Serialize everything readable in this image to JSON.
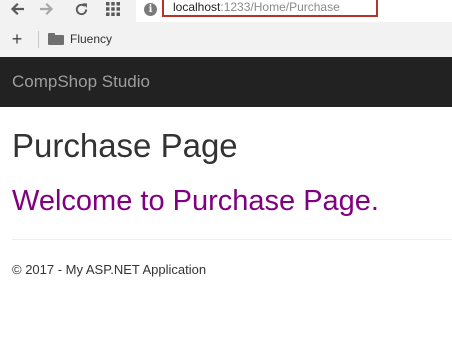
{
  "browser": {
    "url_host": "localhost",
    "url_path": ":1233/Home/Purchase",
    "url_highlight_color": "#b8322a",
    "icons": [
      "back-arrow-icon",
      "forward-arrow-icon",
      "reload-icon",
      "apps-grid-icon",
      "site-info-icon"
    ]
  },
  "bookmarks": {
    "add_label": "+",
    "items": [
      {
        "label": "Fluency",
        "icon": "folder-icon"
      }
    ]
  },
  "navbar": {
    "brand": "CompShop Studio",
    "background": "#222222"
  },
  "main": {
    "title": "Purchase Page",
    "welcome": "Welcome to Purchase Page.",
    "welcome_color": "#800080"
  },
  "footer": {
    "text": "© 2017 - My ASP.NET Application"
  }
}
